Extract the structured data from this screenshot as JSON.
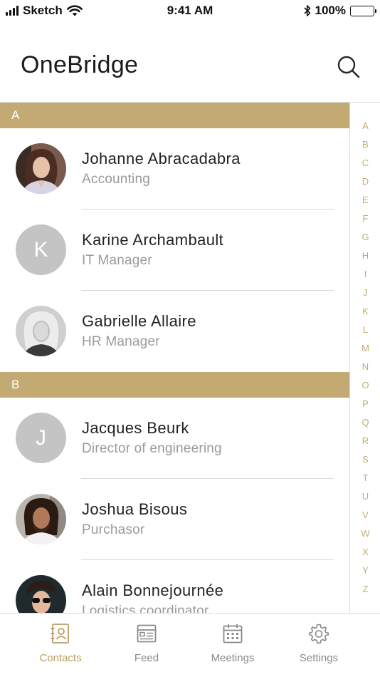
{
  "status_bar": {
    "carrier": "Sketch",
    "time": "9:41 AM",
    "battery": "100%"
  },
  "header": {
    "title": "OneBridge",
    "search_icon": "search-icon"
  },
  "colors": {
    "accent": "#c2aa72",
    "accent_text": "#b89e63",
    "avatar_placeholder": "#c4c4c4"
  },
  "sections": [
    {
      "letter": "A",
      "contacts": [
        {
          "name": "Johanne Abracadabra",
          "role": "Accounting",
          "avatar": "photo"
        },
        {
          "name": "Karine Archambault",
          "role": "IT Manager",
          "avatar": "initial",
          "initial": "K"
        },
        {
          "name": "Gabrielle Allaire",
          "role": "HR Manager",
          "avatar": "photo"
        }
      ]
    },
    {
      "letter": "B",
      "contacts": [
        {
          "name": "Jacques Beurk",
          "role": "Director of engineering",
          "avatar": "initial",
          "initial": "J"
        },
        {
          "name": "Joshua Bisous",
          "role": "Purchasor",
          "avatar": "photo"
        },
        {
          "name": "Alain Bonnejournée",
          "role": "Logistics coordinator",
          "avatar": "photo"
        }
      ]
    }
  ],
  "alphabet_index": [
    "A",
    "B",
    "C",
    "D",
    "E",
    "F",
    "G",
    "H",
    "I",
    "J",
    "K",
    "L",
    "M",
    "N",
    "O",
    "P",
    "Q",
    "R",
    "S",
    "T",
    "U",
    "V",
    "W",
    "X",
    "Y",
    "Z"
  ],
  "tabs": [
    {
      "label": "Contacts",
      "icon": "contacts-icon",
      "active": true
    },
    {
      "label": "Feed",
      "icon": "feed-icon",
      "active": false
    },
    {
      "label": "Meetings",
      "icon": "calendar-icon",
      "active": false
    },
    {
      "label": "Settings",
      "icon": "gear-icon",
      "active": false
    }
  ]
}
